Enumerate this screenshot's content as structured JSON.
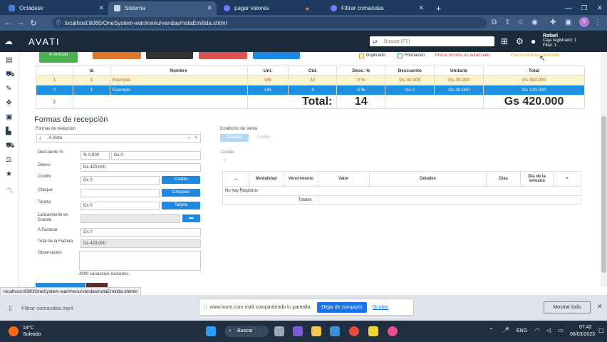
{
  "browser": {
    "tabs": [
      {
        "title": "Octadesk",
        "left": 0
      },
      {
        "title": "Sistema",
        "active": true
      },
      {
        "title": "pagar valores"
      },
      {
        "title": "Filtrar comandas"
      }
    ],
    "url": "localhost:8080/OneSystem-war/menu/vendas/notaEmitida.xhtml",
    "status_url": "localhost:8080/OneSystem-war/menu/vendas/notaEmitida.xhtml#"
  },
  "app": {
    "logo": "AVATI",
    "search_placeholder": "Buscar (F2)",
    "user_name": "Rafael",
    "user_line2": "Caja registrado: 1",
    "user_line3": "Filial: 1"
  },
  "legend": {
    "duplicado": "Duplicado",
    "formacion": "Formación",
    "precio_min": "Precio mínimo no autorizado",
    "precio_min2": "Precio mínimo autorizado"
  },
  "grid": {
    "headers": [
      "Id",
      "Nombre",
      "Uni.",
      "Ctd.",
      "Desc. %",
      "Descuento",
      "Unitario",
      "Total"
    ],
    "rows": [
      {
        "n": "1",
        "id": "1",
        "nombre": "Exemplo",
        "uni": "UN",
        "ctd": "10",
        "desc": "0 %",
        "descuento": "Gs 30.000",
        "unitario": "Gs 30.000",
        "total": "Gs 300.000"
      },
      {
        "n": "2",
        "id": "1",
        "nombre": "Exemplo",
        "uni": "UN",
        "ctd": "4",
        "desc": "0 %",
        "descuento": "Gs 0",
        "unitario": "Gs 30.000",
        "total": "Gs 120.000"
      }
    ],
    "total_row_n": "2",
    "total_label": "Total:",
    "total_qty": "14",
    "total_value": "Gs 420.000"
  },
  "form": {
    "title": "Formas de recepción",
    "forma_label": "Formas de recepción",
    "forma_value": "A Vista",
    "descuento_label": "Descuento %",
    "descuento_pct": "% 0,000",
    "descuento_gs": "Gs 0",
    "dinero_label": "Dinero",
    "dinero_value": "Gs 420.000",
    "credito_label": "Crédito",
    "credito_value": "Gs 0",
    "credito_btn": "Crédito",
    "cheque_label": "Cheque",
    "cheque_btn": "Cheques",
    "tarjeta_label": "Tarjeta",
    "tarjeta_value": "Gs 0",
    "tarjeta_btn": "Tarjeta",
    "lanz_label1": "Lanzamiento en",
    "lanz_label2": "Cuenta",
    "afacturar_label": "A Facturar",
    "afacturar_value": "Gs 0",
    "totalfactura_label": "Total de la Factura",
    "totalfactura_value": "Gs 420.000",
    "observacion_label": "Observación",
    "chars_left": "4000 caracteres restantes."
  },
  "condicion": {
    "label": "Condición de Venta",
    "contado": "Contado",
    "credito": "Crédito",
    "cuotas_label": "Cuotas",
    "cuotas_value": "0"
  },
  "paytable": {
    "headers": [
      "...",
      "Modalidad",
      "Vencimiento",
      "Valor",
      "Detalles",
      "Días",
      "Día de la semana",
      "+"
    ],
    "empty": "No hay Registros",
    "totales": "Totales"
  },
  "download": {
    "file": "Filtrar comandas.mp4",
    "loom_text": "www.loom.com está compartiendo tu pantalla.",
    "stop_btn": "Dejar de compartir",
    "hide_btn": "Ocultar",
    "show_all": "Mostrar todo"
  },
  "taskbar": {
    "weather_temp": "19°C",
    "weather_desc": "Soleado",
    "search": "Buscar",
    "lang": "ENG",
    "time": "07:42",
    "date": "06/03/2023"
  }
}
